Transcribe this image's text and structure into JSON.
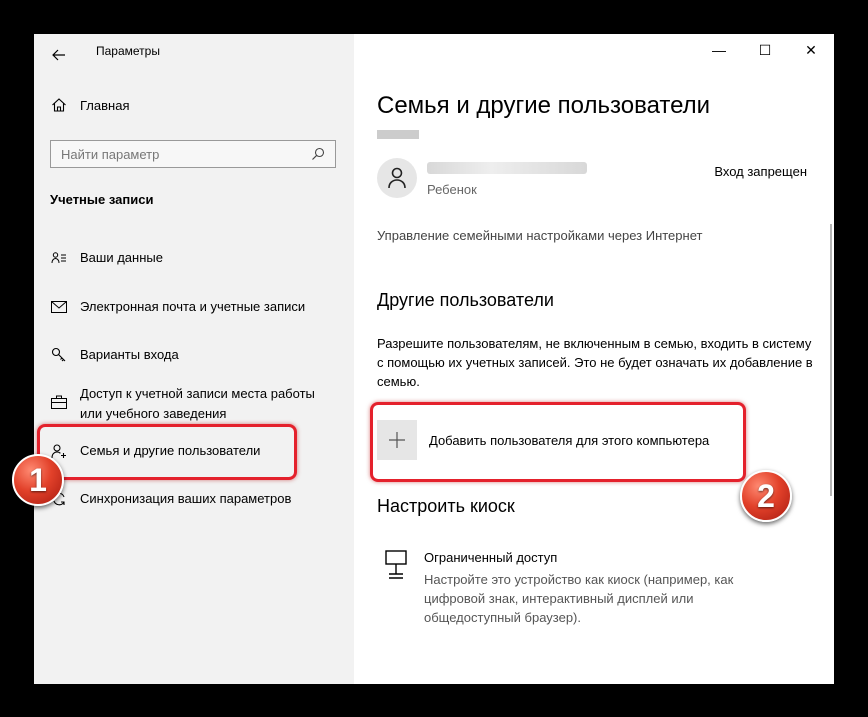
{
  "window": {
    "app_title": "Параметры",
    "controls": {
      "minimize": "—",
      "maximize": "☐",
      "close": "✕"
    }
  },
  "sidebar": {
    "home_label": "Главная",
    "search": {
      "placeholder": "Найти параметр",
      "value": ""
    },
    "section_label": "Учетные записи",
    "items": [
      {
        "label": "Ваши данные",
        "icon": "person-card-icon"
      },
      {
        "label": "Электронная почта и учетные записи",
        "icon": "mail-icon"
      },
      {
        "label": "Варианты входа",
        "icon": "key-icon"
      },
      {
        "label": "Доступ к учетной записи места работы или учебного заведения",
        "icon": "briefcase-icon"
      },
      {
        "label": "Семья и другие пользователи",
        "icon": "person-add-icon",
        "selected": true
      },
      {
        "label": "Синхронизация ваших параметров",
        "icon": "sync-icon"
      }
    ]
  },
  "main": {
    "title": "Семья и другие пользователи",
    "account": {
      "type": "Ребенок",
      "status": "Вход запрещен"
    },
    "family_link": "Управление семейными настройками через Интернет",
    "other_users": {
      "heading": "Другие пользователи",
      "description": "Разрешите пользователям, не включенным в семью, входить в систему с помощью их учетных записей. Это не будет означать их добавление в семью.",
      "add_label": "Добавить пользователя для этого компьютера"
    },
    "kiosk": {
      "heading": "Настроить киоск",
      "title": "Ограниченный доступ",
      "description": "Настройте это устройство как киоск (например, как цифровой знак, интерактивный дисплей или общедоступный браузер)."
    }
  },
  "annotations": {
    "badge1": "1",
    "badge2": "2",
    "color": "#e4212c"
  }
}
